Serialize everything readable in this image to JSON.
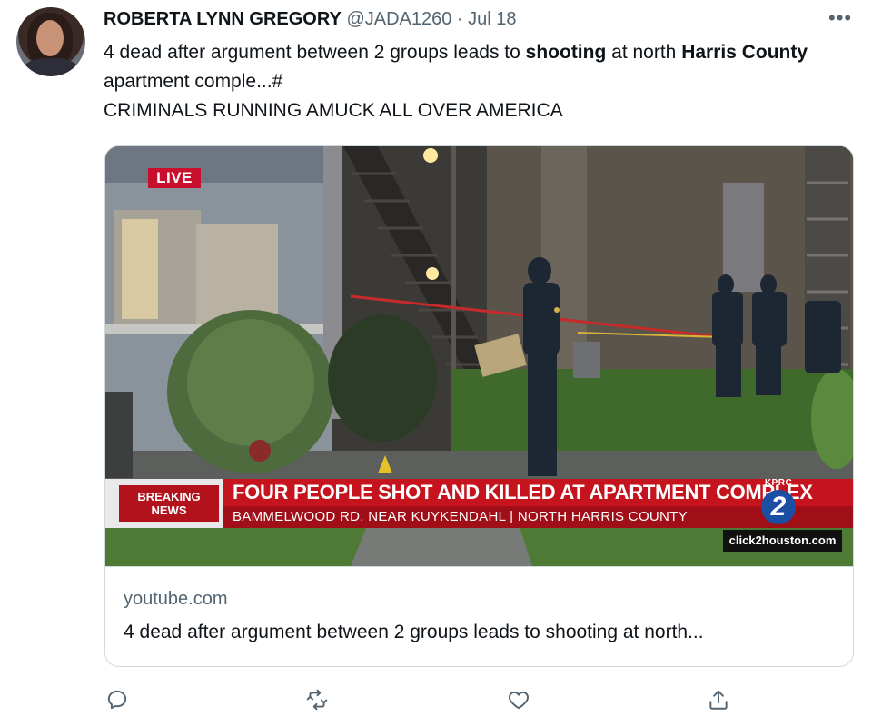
{
  "tweet": {
    "author_name": "ROBERTA LYNN GREGORY",
    "handle": "@JADA1260",
    "separator": "·",
    "date": "Jul 18",
    "more_label": "•••",
    "text": {
      "seg1": "4 dead after argument between 2 groups leads to ",
      "seg2_bold": "shooting",
      "seg3": " at north ",
      "seg4_bold": "Harris County",
      "seg5": " apartment comple...#",
      "line2": "CRIMINALS RUNNING AMUCK ALL OVER AMERICA"
    }
  },
  "card": {
    "video": {
      "live_label": "LIVE",
      "breaking_label": "BREAKING NEWS",
      "headline": "FOUR PEOPLE SHOT AND KILLED AT APARTMENT COMPLEX",
      "subline": "BAMMELWOOD RD. NEAR KUYKENDAHL |  NORTH HARRIS COUNTY",
      "station_call": "KPRC",
      "station_number": "2",
      "site": "click2houston.com"
    },
    "domain": "youtube.com",
    "title": "4 dead after argument between 2 groups leads to shooting at north..."
  },
  "actions": {
    "reply_icon": "reply-icon",
    "retweet_icon": "retweet-icon",
    "like_icon": "heart-icon",
    "share_icon": "share-icon"
  },
  "colors": {
    "breaking_red": "#c5141d",
    "muted_text": "#536471",
    "border": "#cfd9de"
  }
}
